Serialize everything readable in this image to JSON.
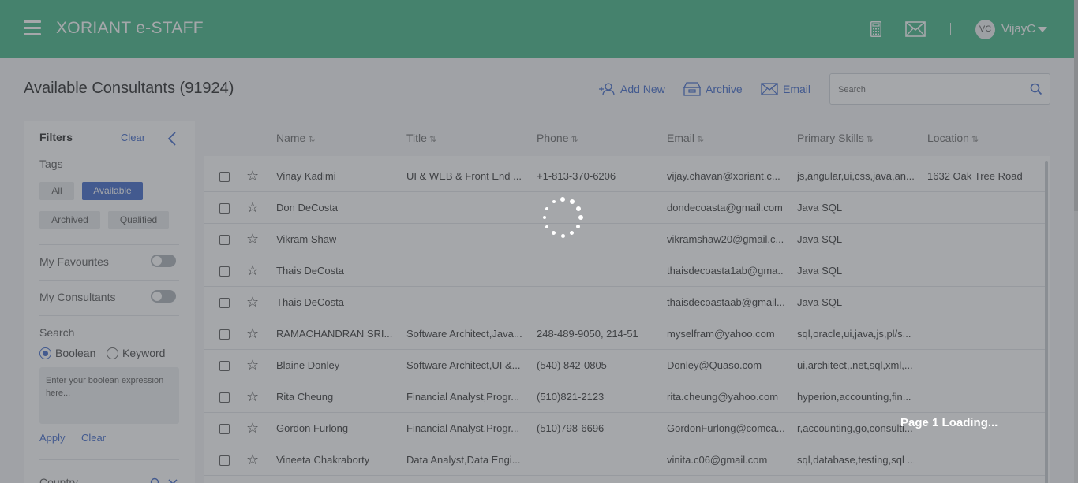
{
  "header": {
    "brand": "XORIANT e-STAFF",
    "avatar_initials": "VC",
    "username": "VijayC",
    "icons": [
      "menu-icon",
      "calculator-icon",
      "mail-icon",
      "chevron-down-icon"
    ]
  },
  "page": {
    "title": "Available Consultants (91924)",
    "actions": {
      "add_new": "Add New",
      "archive": "Archive",
      "email": "Email"
    },
    "search_placeholder": "Search"
  },
  "filters": {
    "title": "Filters",
    "clear": "Clear",
    "tags_label": "Tags",
    "tags": [
      {
        "label": "All",
        "active": false
      },
      {
        "label": "Available",
        "active": true
      },
      {
        "label": "Archived",
        "active": false
      },
      {
        "label": "Qualified",
        "active": false
      }
    ],
    "my_favourites": "My Favourites",
    "my_consultants": "My Consultants",
    "search_label": "Search",
    "boolean_label": "Boolean",
    "keyword_label": "Keyword",
    "boolean_placeholder": "Enter your boolean expression here...",
    "apply": "Apply",
    "clear_search": "Clear",
    "country_label": "Country"
  },
  "table": {
    "columns": [
      "Name",
      "Title",
      "Phone",
      "Email",
      "Primary Skills",
      "Location"
    ],
    "sort_glyph": "⇅",
    "rows": [
      {
        "name": "Vinay Kadimi",
        "title": "UI & WEB & Front End ...",
        "phone": "+1-813-370-6206",
        "email": "vijay.chavan@xoriant.c...",
        "skills": "js,angular,ui,css,java,an...",
        "location": "1632 Oak Tree Road"
      },
      {
        "name": "Don DeCosta",
        "title": "",
        "phone": "",
        "email": "dondecoasta@gmail.com",
        "skills": "Java SQL",
        "location": ""
      },
      {
        "name": "Vikram Shaw",
        "title": "",
        "phone": "",
        "email": "vikramshaw20@gmail.c...",
        "skills": "Java SQL",
        "location": ""
      },
      {
        "name": "Thais DeCosta",
        "title": "",
        "phone": "",
        "email": "thaisdecoasta1ab@gma...",
        "skills": "Java SQL",
        "location": ""
      },
      {
        "name": "Thais DeCosta",
        "title": "",
        "phone": "",
        "email": "thaisdecoastaab@gmail...",
        "skills": "Java SQL",
        "location": ""
      },
      {
        "name": "RAMACHANDRAN SRI...",
        "title": "Software Architect,Java...",
        "phone": "248-489-9050, 214-51",
        "email": "myselfram@yahoo.com",
        "skills": "sql,oracle,ui,java,js,pl/s...",
        "location": ""
      },
      {
        "name": "Blaine Donley",
        "title": "Software Architect,UI &...",
        "phone": "(540) 842-0805",
        "email": "Donley@Quaso.com",
        "skills": "ui,architect,.net,sql,xml,...",
        "location": ""
      },
      {
        "name": "Rita Cheung",
        "title": "Financial Analyst,Progr...",
        "phone": "(510)821-2123",
        "email": "rita.cheung@yahoo.com",
        "skills": "hyperion,accounting,fin...",
        "location": ""
      },
      {
        "name": "Gordon Furlong",
        "title": "Financial Analyst,Progr...",
        "phone": "(510)798-6696",
        "email": "GordonFurlong@comca...",
        "skills": "r,accounting,go,consulti...",
        "location": ""
      },
      {
        "name": "Vineeta Chakraborty",
        "title": "Data Analyst,Data Engi...",
        "phone": "",
        "email": "vinita.c06@gmail.com",
        "skills": "sql,database,testing,sql ...",
        "location": ""
      }
    ]
  },
  "loading": {
    "text": "Page 1 Loading..."
  },
  "colors": {
    "header": "#3fb585",
    "accent": "#3a64c8",
    "overlay": "rgba(75,80,86,0.5)"
  }
}
